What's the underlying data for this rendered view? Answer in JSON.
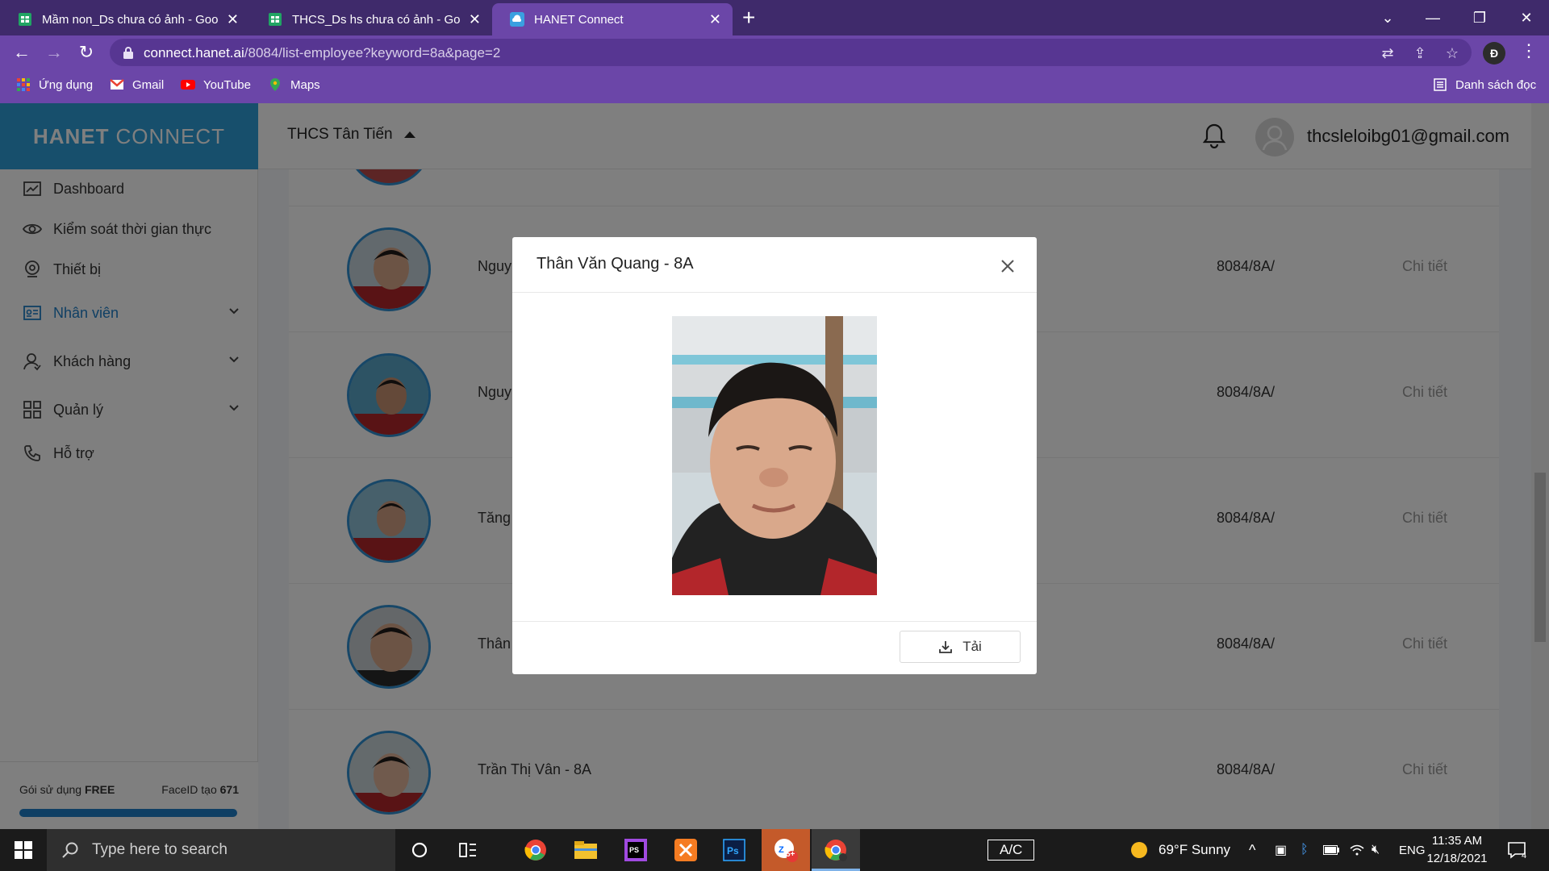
{
  "browser": {
    "tabs": [
      {
        "title": "Mầm non_Ds chưa có ảnh - Goo",
        "icon": "sheets-icon",
        "active": false
      },
      {
        "title": "THCS_Ds hs chưa có ảnh - Googl",
        "icon": "sheets-icon",
        "active": false
      },
      {
        "title": "HANET Connect",
        "icon": "hanet-cloud-icon",
        "active": true
      }
    ],
    "url_host": "connect.hanet.ai",
    "url_path": "/8084/list-employee?keyword=8a&page=2",
    "profile_initial": "Đ",
    "bookmarks": [
      {
        "label": "Ứng dụng",
        "icon": "apps-grid-icon"
      },
      {
        "label": "Gmail",
        "icon": "gmail-icon"
      },
      {
        "label": "YouTube",
        "icon": "youtube-icon"
      },
      {
        "label": "Maps",
        "icon": "maps-icon"
      }
    ],
    "reading_list": "Danh sách đọc"
  },
  "app": {
    "brand_bold": "HANET",
    "brand_light": "CONNECT",
    "org_name": "THCS Tân Tiến",
    "user_email": "thcsleloibg01@gmail.com",
    "nav": [
      {
        "label": "Dashboard",
        "icon": "chart-icon"
      },
      {
        "label": "Kiểm soát thời gian thực",
        "icon": "eye-icon"
      },
      {
        "label": "Thiết bị",
        "icon": "camera-device-icon"
      },
      {
        "label": "Nhân viên",
        "icon": "id-card-icon",
        "active": true
      },
      {
        "label": "Khách hàng",
        "icon": "user-icon"
      },
      {
        "label": "Quản lý",
        "icon": "grid-icon"
      },
      {
        "label": "Hỗ trợ",
        "icon": "phone-icon"
      }
    ],
    "plan_label": "Gói sử dụng",
    "plan_value": "FREE",
    "faceid_label": "FaceID tạo",
    "faceid_value": "671",
    "plan_usage_fraction": 1.0
  },
  "employees": [
    {
      "name": "Nguy",
      "code": "8084/8A/",
      "detail": "Chi tiết"
    },
    {
      "name": "Nguy",
      "code": "8084/8A/",
      "detail": "Chi tiết"
    },
    {
      "name": "Tăng",
      "code": "8084/8A/",
      "detail": "Chi tiết"
    },
    {
      "name": "Thân",
      "code": "8084/8A/",
      "detail": "Chi tiết"
    },
    {
      "name": "Trần Thị Vân - 8A",
      "code": "8084/8A/",
      "detail": "Chi tiết"
    }
  ],
  "modal": {
    "title": "Thân Văn Quang - 8A",
    "download_label": "Tải"
  },
  "taskbar": {
    "search_placeholder": "Type here to search",
    "zalo_badge": "5+",
    "keyboard_label": "A/C",
    "weather": "69°F  Sunny",
    "lang": "ENG",
    "time": "11:35 AM",
    "date": "12/18/2021",
    "notifications": "4"
  }
}
